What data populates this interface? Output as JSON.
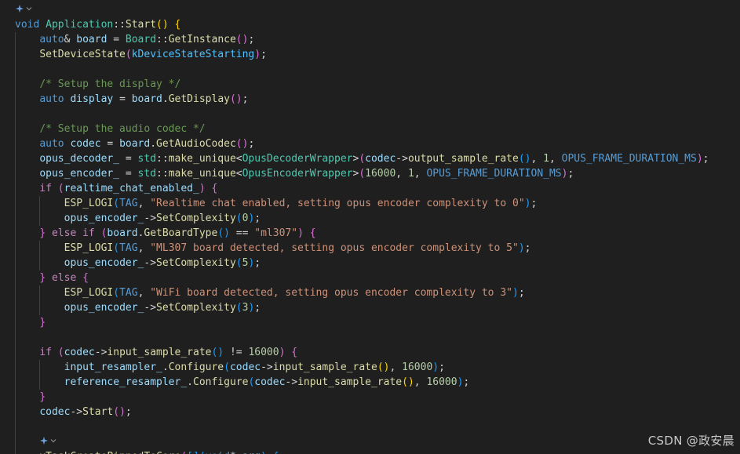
{
  "editor": {
    "theme_colors": {
      "background": "#1f1f1f",
      "keyword": "#569cd6",
      "control": "#c586c0",
      "type": "#4ec9b0",
      "function": "#dcdcaa",
      "variable": "#9cdcfe",
      "constant": "#4fc1ff",
      "string": "#ce9178",
      "number": "#b5cea8",
      "comment": "#6a9955",
      "bracket_level_1": "#ffd700",
      "bracket_level_2": "#da70d6",
      "bracket_level_3": "#179fff"
    },
    "lines": [
      {
        "kind": "codelens",
        "indent": 0,
        "tokens": [
          {
            "t": "lens-icon",
            "c": "icon"
          }
        ]
      },
      {
        "indent": 0,
        "tokens": [
          {
            "t": "void",
            "c": "kw"
          },
          {
            "t": " ",
            "c": "plain"
          },
          {
            "t": "Application",
            "c": "type"
          },
          {
            "t": "::",
            "c": "op"
          },
          {
            "t": "Start",
            "c": "fn"
          },
          {
            "t": "()",
            "c": "b1"
          },
          {
            "t": " ",
            "c": "plain"
          },
          {
            "t": "{",
            "c": "b1"
          }
        ]
      },
      {
        "indent": 1,
        "tokens": [
          {
            "t": "auto",
            "c": "kw"
          },
          {
            "t": "& ",
            "c": "op"
          },
          {
            "t": "board",
            "c": "var"
          },
          {
            "t": " = ",
            "c": "op"
          },
          {
            "t": "Board",
            "c": "type"
          },
          {
            "t": "::",
            "c": "op"
          },
          {
            "t": "GetInstance",
            "c": "fn"
          },
          {
            "t": "()",
            "c": "b2"
          },
          {
            "t": ";",
            "c": "op"
          }
        ]
      },
      {
        "indent": 1,
        "tokens": [
          {
            "t": "SetDeviceState",
            "c": "fn"
          },
          {
            "t": "(",
            "c": "b2"
          },
          {
            "t": "kDeviceStateStarting",
            "c": "const"
          },
          {
            "t": ")",
            "c": "b2"
          },
          {
            "t": ";",
            "c": "op"
          }
        ]
      },
      {
        "indent": 0,
        "tokens": []
      },
      {
        "indent": 1,
        "tokens": [
          {
            "t": "/* Setup the display */",
            "c": "cmt"
          }
        ]
      },
      {
        "indent": 1,
        "tokens": [
          {
            "t": "auto",
            "c": "kw"
          },
          {
            "t": " ",
            "c": "plain"
          },
          {
            "t": "display",
            "c": "var"
          },
          {
            "t": " = ",
            "c": "op"
          },
          {
            "t": "board",
            "c": "var"
          },
          {
            "t": ".",
            "c": "op"
          },
          {
            "t": "GetDisplay",
            "c": "fn"
          },
          {
            "t": "()",
            "c": "b2"
          },
          {
            "t": ";",
            "c": "op"
          }
        ]
      },
      {
        "indent": 0,
        "tokens": []
      },
      {
        "indent": 1,
        "tokens": [
          {
            "t": "/* Setup the audio codec */",
            "c": "cmt"
          }
        ]
      },
      {
        "indent": 1,
        "tokens": [
          {
            "t": "auto",
            "c": "kw"
          },
          {
            "t": " ",
            "c": "plain"
          },
          {
            "t": "codec",
            "c": "var"
          },
          {
            "t": " = ",
            "c": "op"
          },
          {
            "t": "board",
            "c": "var"
          },
          {
            "t": ".",
            "c": "op"
          },
          {
            "t": "GetAudioCodec",
            "c": "fn"
          },
          {
            "t": "()",
            "c": "b2"
          },
          {
            "t": ";",
            "c": "op"
          }
        ]
      },
      {
        "indent": 1,
        "tokens": [
          {
            "t": "opus_decoder_",
            "c": "var"
          },
          {
            "t": " = ",
            "c": "op"
          },
          {
            "t": "std",
            "c": "type"
          },
          {
            "t": "::",
            "c": "op"
          },
          {
            "t": "make_unique",
            "c": "fn"
          },
          {
            "t": "<",
            "c": "op"
          },
          {
            "t": "OpusDecoderWrapper",
            "c": "type"
          },
          {
            "t": ">",
            "c": "op"
          },
          {
            "t": "(",
            "c": "b2"
          },
          {
            "t": "codec",
            "c": "var"
          },
          {
            "t": "->",
            "c": "op"
          },
          {
            "t": "output_sample_rate",
            "c": "fn"
          },
          {
            "t": "()",
            "c": "b3"
          },
          {
            "t": ", ",
            "c": "op"
          },
          {
            "t": "1",
            "c": "num"
          },
          {
            "t": ", ",
            "c": "op"
          },
          {
            "t": "OPUS_FRAME_DURATION_MS",
            "c": "macro"
          },
          {
            "t": ")",
            "c": "b2"
          },
          {
            "t": ";",
            "c": "op"
          }
        ]
      },
      {
        "indent": 1,
        "tokens": [
          {
            "t": "opus_encoder_",
            "c": "var"
          },
          {
            "t": " = ",
            "c": "op"
          },
          {
            "t": "std",
            "c": "type"
          },
          {
            "t": "::",
            "c": "op"
          },
          {
            "t": "make_unique",
            "c": "fn"
          },
          {
            "t": "<",
            "c": "op"
          },
          {
            "t": "OpusEncoderWrapper",
            "c": "type"
          },
          {
            "t": ">",
            "c": "op"
          },
          {
            "t": "(",
            "c": "b2"
          },
          {
            "t": "16000",
            "c": "num"
          },
          {
            "t": ", ",
            "c": "op"
          },
          {
            "t": "1",
            "c": "num"
          },
          {
            "t": ", ",
            "c": "op"
          },
          {
            "t": "OPUS_FRAME_DURATION_MS",
            "c": "macro"
          },
          {
            "t": ")",
            "c": "b2"
          },
          {
            "t": ";",
            "c": "op"
          }
        ]
      },
      {
        "indent": 1,
        "tokens": [
          {
            "t": "if",
            "c": "ctrl"
          },
          {
            "t": " ",
            "c": "plain"
          },
          {
            "t": "(",
            "c": "b2"
          },
          {
            "t": "realtime_chat_enabled_",
            "c": "var"
          },
          {
            "t": ")",
            "c": "b2"
          },
          {
            "t": " ",
            "c": "plain"
          },
          {
            "t": "{",
            "c": "b2"
          }
        ]
      },
      {
        "indent": 2,
        "tokens": [
          {
            "t": "ESP_LOGI",
            "c": "fn"
          },
          {
            "t": "(",
            "c": "b3"
          },
          {
            "t": "TAG",
            "c": "macro"
          },
          {
            "t": ", ",
            "c": "op"
          },
          {
            "t": "\"Realtime chat enabled, setting opus encoder complexity to 0\"",
            "c": "str"
          },
          {
            "t": ")",
            "c": "b3"
          },
          {
            "t": ";",
            "c": "op"
          }
        ]
      },
      {
        "indent": 2,
        "tokens": [
          {
            "t": "opus_encoder_",
            "c": "var"
          },
          {
            "t": "->",
            "c": "op"
          },
          {
            "t": "SetComplexity",
            "c": "fn"
          },
          {
            "t": "(",
            "c": "b3"
          },
          {
            "t": "0",
            "c": "num"
          },
          {
            "t": ")",
            "c": "b3"
          },
          {
            "t": ";",
            "c": "op"
          }
        ]
      },
      {
        "indent": 1,
        "tokens": [
          {
            "t": "}",
            "c": "b2"
          },
          {
            "t": " ",
            "c": "plain"
          },
          {
            "t": "else",
            "c": "ctrl"
          },
          {
            "t": " ",
            "c": "plain"
          },
          {
            "t": "if",
            "c": "ctrl"
          },
          {
            "t": " ",
            "c": "plain"
          },
          {
            "t": "(",
            "c": "b2"
          },
          {
            "t": "board",
            "c": "var"
          },
          {
            "t": ".",
            "c": "op"
          },
          {
            "t": "GetBoardType",
            "c": "fn"
          },
          {
            "t": "()",
            "c": "b3"
          },
          {
            "t": " == ",
            "c": "op"
          },
          {
            "t": "\"ml307\"",
            "c": "str"
          },
          {
            "t": ")",
            "c": "b2"
          },
          {
            "t": " ",
            "c": "plain"
          },
          {
            "t": "{",
            "c": "b2"
          }
        ]
      },
      {
        "indent": 2,
        "tokens": [
          {
            "t": "ESP_LOGI",
            "c": "fn"
          },
          {
            "t": "(",
            "c": "b3"
          },
          {
            "t": "TAG",
            "c": "macro"
          },
          {
            "t": ", ",
            "c": "op"
          },
          {
            "t": "\"ML307 board detected, setting opus encoder complexity to 5\"",
            "c": "str"
          },
          {
            "t": ")",
            "c": "b3"
          },
          {
            "t": ";",
            "c": "op"
          }
        ]
      },
      {
        "indent": 2,
        "tokens": [
          {
            "t": "opus_encoder_",
            "c": "var"
          },
          {
            "t": "->",
            "c": "op"
          },
          {
            "t": "SetComplexity",
            "c": "fn"
          },
          {
            "t": "(",
            "c": "b3"
          },
          {
            "t": "5",
            "c": "num"
          },
          {
            "t": ")",
            "c": "b3"
          },
          {
            "t": ";",
            "c": "op"
          }
        ]
      },
      {
        "indent": 1,
        "tokens": [
          {
            "t": "}",
            "c": "b2"
          },
          {
            "t": " ",
            "c": "plain"
          },
          {
            "t": "else",
            "c": "ctrl"
          },
          {
            "t": " ",
            "c": "plain"
          },
          {
            "t": "{",
            "c": "b2"
          }
        ]
      },
      {
        "indent": 2,
        "tokens": [
          {
            "t": "ESP_LOGI",
            "c": "fn"
          },
          {
            "t": "(",
            "c": "b3"
          },
          {
            "t": "TAG",
            "c": "macro"
          },
          {
            "t": ", ",
            "c": "op"
          },
          {
            "t": "\"WiFi board detected, setting opus encoder complexity to 3\"",
            "c": "str"
          },
          {
            "t": ")",
            "c": "b3"
          },
          {
            "t": ";",
            "c": "op"
          }
        ]
      },
      {
        "indent": 2,
        "tokens": [
          {
            "t": "opus_encoder_",
            "c": "var"
          },
          {
            "t": "->",
            "c": "op"
          },
          {
            "t": "SetComplexity",
            "c": "fn"
          },
          {
            "t": "(",
            "c": "b3"
          },
          {
            "t": "3",
            "c": "num"
          },
          {
            "t": ")",
            "c": "b3"
          },
          {
            "t": ";",
            "c": "op"
          }
        ]
      },
      {
        "indent": 1,
        "tokens": [
          {
            "t": "}",
            "c": "b2"
          }
        ]
      },
      {
        "indent": 0,
        "tokens": []
      },
      {
        "indent": 1,
        "tokens": [
          {
            "t": "if",
            "c": "ctrl"
          },
          {
            "t": " ",
            "c": "plain"
          },
          {
            "t": "(",
            "c": "b2"
          },
          {
            "t": "codec",
            "c": "var"
          },
          {
            "t": "->",
            "c": "op"
          },
          {
            "t": "input_sample_rate",
            "c": "fn"
          },
          {
            "t": "()",
            "c": "b3"
          },
          {
            "t": " != ",
            "c": "op"
          },
          {
            "t": "16000",
            "c": "num"
          },
          {
            "t": ")",
            "c": "b2"
          },
          {
            "t": " ",
            "c": "plain"
          },
          {
            "t": "{",
            "c": "b2"
          }
        ]
      },
      {
        "indent": 2,
        "tokens": [
          {
            "t": "input_resampler_",
            "c": "var"
          },
          {
            "t": ".",
            "c": "op"
          },
          {
            "t": "Configure",
            "c": "fn"
          },
          {
            "t": "(",
            "c": "b3"
          },
          {
            "t": "codec",
            "c": "var"
          },
          {
            "t": "->",
            "c": "op"
          },
          {
            "t": "input_sample_rate",
            "c": "fn"
          },
          {
            "t": "()",
            "c": "b1"
          },
          {
            "t": ", ",
            "c": "op"
          },
          {
            "t": "16000",
            "c": "num"
          },
          {
            "t": ")",
            "c": "b3"
          },
          {
            "t": ";",
            "c": "op"
          }
        ]
      },
      {
        "indent": 2,
        "tokens": [
          {
            "t": "reference_resampler_",
            "c": "var"
          },
          {
            "t": ".",
            "c": "op"
          },
          {
            "t": "Configure",
            "c": "fn"
          },
          {
            "t": "(",
            "c": "b3"
          },
          {
            "t": "codec",
            "c": "var"
          },
          {
            "t": "->",
            "c": "op"
          },
          {
            "t": "input_sample_rate",
            "c": "fn"
          },
          {
            "t": "()",
            "c": "b1"
          },
          {
            "t": ", ",
            "c": "op"
          },
          {
            "t": "16000",
            "c": "num"
          },
          {
            "t": ")",
            "c": "b3"
          },
          {
            "t": ";",
            "c": "op"
          }
        ]
      },
      {
        "indent": 1,
        "tokens": [
          {
            "t": "}",
            "c": "b2"
          }
        ]
      },
      {
        "indent": 1,
        "tokens": [
          {
            "t": "codec",
            "c": "var"
          },
          {
            "t": "->",
            "c": "op"
          },
          {
            "t": "Start",
            "c": "fn"
          },
          {
            "t": "()",
            "c": "b2"
          },
          {
            "t": ";",
            "c": "op"
          }
        ]
      },
      {
        "indent": 0,
        "tokens": []
      },
      {
        "kind": "codelens",
        "indent": 1,
        "tokens": [
          {
            "t": "lens-icon",
            "c": "icon"
          }
        ]
      },
      {
        "indent": 1,
        "tokens": [
          {
            "t": "xTaskCreatePinnedToCore",
            "c": "fn"
          },
          {
            "t": "(",
            "c": "b2"
          },
          {
            "t": "[",
            "c": "b3"
          },
          {
            "t": "]",
            "c": "b3"
          },
          {
            "t": "(",
            "c": "b3"
          },
          {
            "t": "void",
            "c": "kw"
          },
          {
            "t": "* ",
            "c": "op"
          },
          {
            "t": "arg",
            "c": "var"
          },
          {
            "t": ")",
            "c": "b3"
          },
          {
            "t": " ",
            "c": "plain"
          },
          {
            "t": "{",
            "c": "b3"
          }
        ]
      }
    ]
  },
  "watermark": {
    "text": "CSDN @政安晨"
  }
}
